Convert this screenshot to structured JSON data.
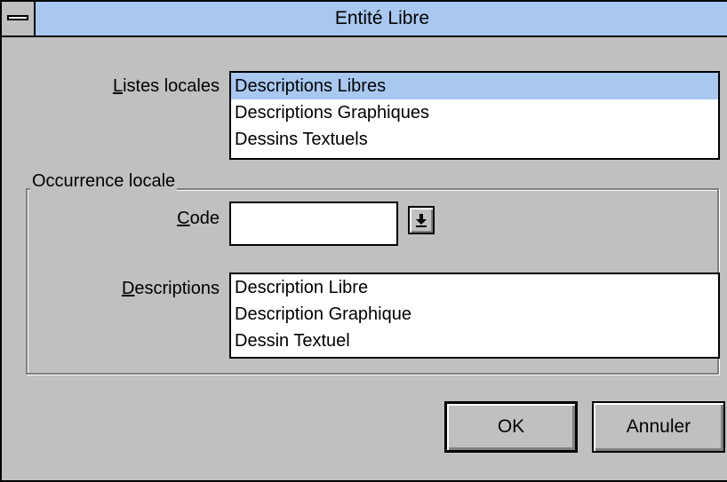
{
  "window": {
    "title": "Entité Libre"
  },
  "listes_locales": {
    "label_prefix": "",
    "label_mnemonic": "L",
    "label_rest": "istes locales",
    "items": [
      "Descriptions Libres",
      "Descriptions Graphiques",
      "Dessins Textuels"
    ],
    "selected_index": 0
  },
  "occurrence_locale": {
    "group_title": "Occurrence locale",
    "code": {
      "label_mnemonic": "C",
      "label_rest": "ode",
      "value": ""
    },
    "descriptions": {
      "label_mnemonic": "D",
      "label_rest": "escriptions",
      "items": [
        "Description Libre",
        "Description Graphique",
        "Dessin Textuel"
      ]
    }
  },
  "buttons": {
    "ok": "OK",
    "cancel": "Annuler"
  },
  "icons": {
    "system_menu": "system-menu-icon",
    "dropdown": "dropdown-arrow-icon"
  },
  "colors": {
    "title_bar": "#a8c8f0",
    "selection": "#a8c8f0",
    "window_bg": "#c0c0c0"
  }
}
